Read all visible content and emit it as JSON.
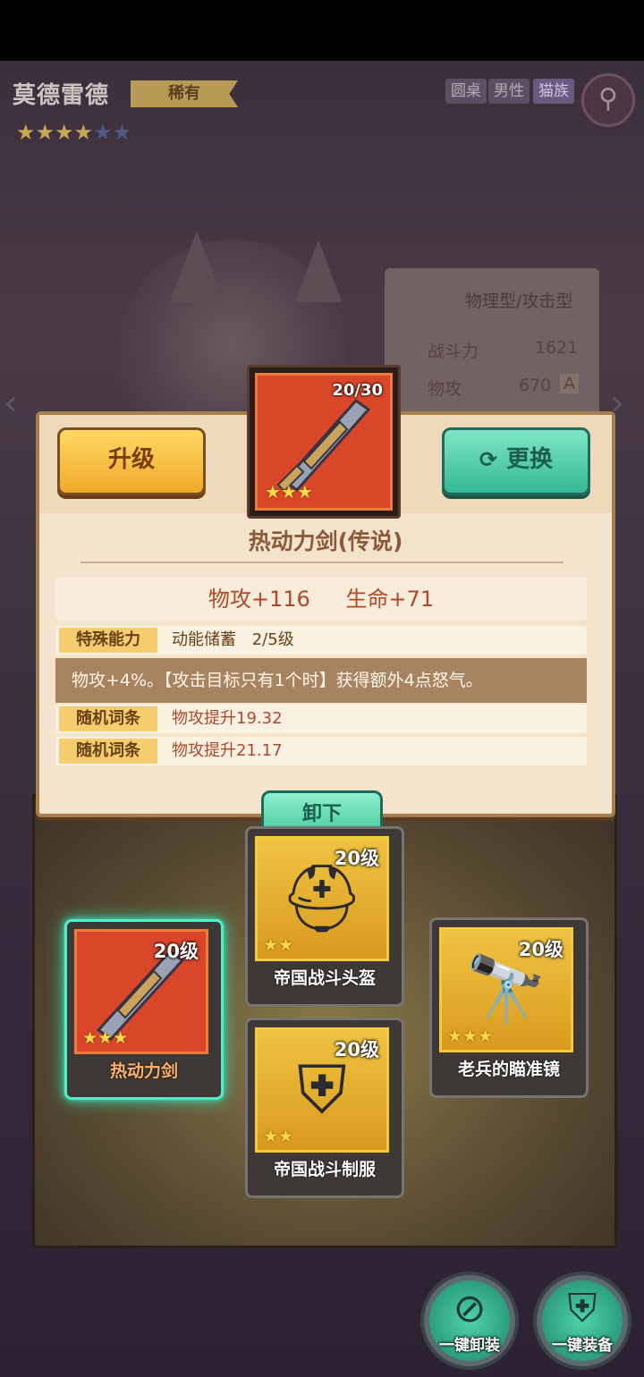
{
  "hero": {
    "name": "莫德雷德",
    "rarity": "稀有",
    "tags": [
      "圆桌",
      "男性",
      "猫族"
    ]
  },
  "stat_card": {
    "type": "物理型/攻击型",
    "power_label": "战斗力",
    "power_value": "1621",
    "atk_label": "物攻",
    "atk_value": "670",
    "grade": "A"
  },
  "detail": {
    "upgrade_label": "升级",
    "replace_label": "更换",
    "durability": "20/30",
    "title": "热动力剑(传说)",
    "main_stats": [
      "物攻+116",
      "生命+71"
    ],
    "special_label": "特殊能力",
    "special_name": "动能储蓄",
    "special_level": "2/5级",
    "special_desc": "物攻+4%。【攻击目标只有1个时】获得额外4点怒气。",
    "random_rows": [
      {
        "label": "随机词条",
        "value": "物攻提升",
        "number": "19.32"
      },
      {
        "label": "随机词条",
        "value": "物攻提升",
        "number": "21.17"
      }
    ]
  },
  "board": {
    "unequip_label": "卸下",
    "slots": [
      {
        "id": "weapon",
        "name": "热动力剑",
        "level": "20级",
        "selected": true
      },
      {
        "id": "helmet",
        "name": "帝国战斗头盔",
        "level": "20级",
        "selected": false
      },
      {
        "id": "armor",
        "name": "帝国战斗制服",
        "level": "20级",
        "selected": false
      },
      {
        "id": "accessory",
        "name": "老兵的瞄准镜",
        "level": "20级",
        "selected": false
      }
    ]
  },
  "actions": {
    "unequip_all": "一键卸装",
    "equip_all": "一键装备"
  },
  "colors": {
    "accent_teal": "#3fc39c",
    "accent_yellow": "#f0a92a",
    "selected_glow": "#36d9b0"
  }
}
